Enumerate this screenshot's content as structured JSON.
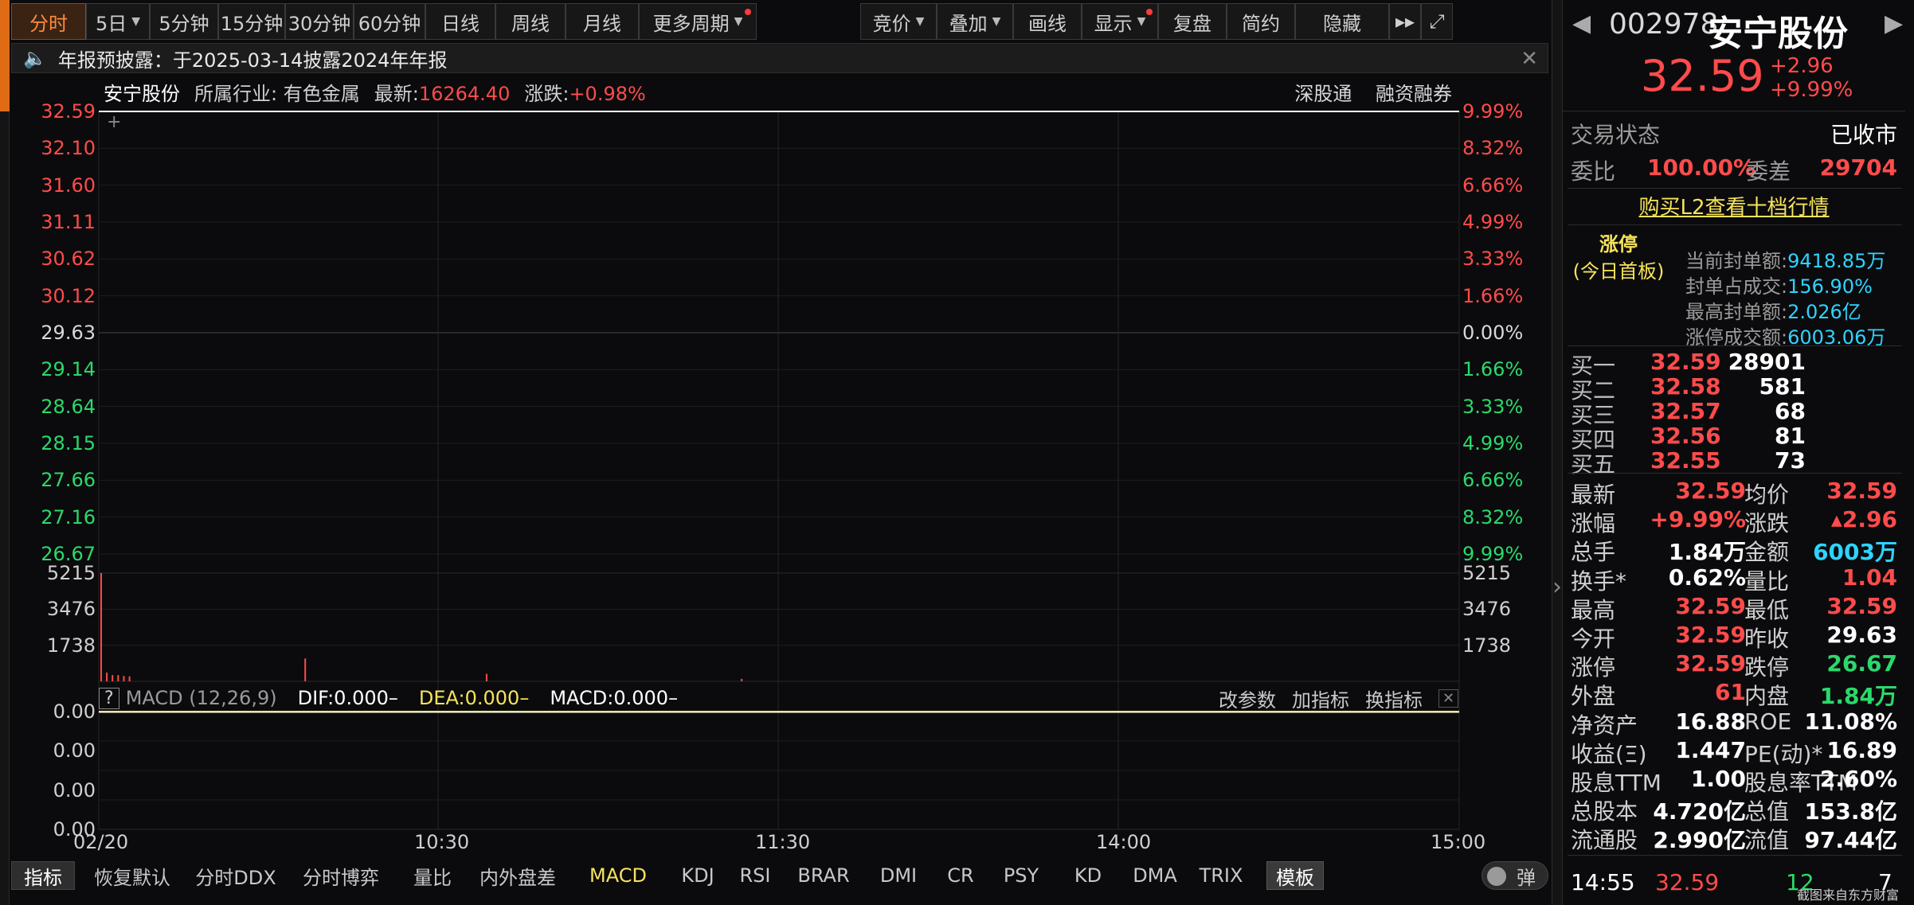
{
  "toolbar": {
    "items": [
      {
        "label": "分时",
        "active": true
      },
      {
        "label": "5日",
        "dropdown": true
      },
      {
        "label": "5分钟"
      },
      {
        "label": "15分钟"
      },
      {
        "label": "30分钟"
      },
      {
        "label": "60分钟"
      },
      {
        "label": "日线"
      },
      {
        "label": "周线"
      },
      {
        "label": "月线"
      },
      {
        "label": "更多周期",
        "dropdown": true,
        "dot": true
      },
      {
        "label": "竞价",
        "dropdown": true
      },
      {
        "label": "叠加",
        "dropdown": true
      },
      {
        "label": "画线"
      },
      {
        "label": "显示",
        "dropdown": true,
        "dot": true
      },
      {
        "label": "复盘"
      },
      {
        "label": "简约"
      },
      {
        "label": "隐藏"
      }
    ]
  },
  "announcement": {
    "text": "年报预披露：于2025-03-14披露2024年年报"
  },
  "info": {
    "stock": "安宁股份",
    "industry_label": "所属行业:",
    "industry": "有色金属",
    "latest_label": "最新:",
    "latest": "16264.40",
    "change_label": "涨跌:",
    "change": "+0.98%",
    "link1": "深股通",
    "link2": "融资融券"
  },
  "price_axis": {
    "left": [
      "32.59",
      "32.10",
      "31.60",
      "31.11",
      "30.62",
      "30.12",
      "29.63",
      "29.14",
      "28.64",
      "28.15",
      "27.66",
      "27.16",
      "26.67"
    ],
    "right": [
      "9.99%",
      "8.32%",
      "6.66%",
      "4.99%",
      "3.33%",
      "1.66%",
      "0.00%",
      "1.66%",
      "3.33%",
      "4.99%",
      "6.66%",
      "8.32%",
      "9.99%"
    ]
  },
  "volume_axis": [
    "5215",
    "3476",
    "1738"
  ],
  "macd_axis": [
    "0.00",
    "0.00",
    "0.00",
    "0.00"
  ],
  "time_axis": [
    "02/20",
    "10:30",
    "11:30",
    "14:00",
    "15:00"
  ],
  "chart_data": {
    "type": "line",
    "title": "",
    "price_line": {
      "x": [
        "09:30",
        "15:00"
      ],
      "y": [
        32.59,
        32.59
      ]
    },
    "prev_close": 29.63,
    "ylim": [
      26.67,
      32.59
    ],
    "volume": {
      "x": [
        "09:30",
        "09:31",
        "09:32",
        "09:33",
        "09:34",
        "09:35",
        "10:06",
        "10:38",
        "11:23"
      ],
      "y": [
        5215,
        420,
        300,
        300,
        260,
        240,
        1100,
        360,
        120
      ]
    },
    "volume_ylim": [
      0,
      5215
    ],
    "macd": {
      "DIF": 0.0,
      "DEA": 0.0,
      "MACD": 0.0
    }
  },
  "macd_bar": {
    "help": "?",
    "name": "MACD (12,26,9)",
    "dif": "DIF:0.000–",
    "dea": "DEA:0.000–",
    "macd": "MACD:0.000–",
    "actions": [
      "改参数",
      "加指标",
      "换指标"
    ]
  },
  "bottom_bar": {
    "items": [
      "指标",
      "恢复默认",
      "分时DDX",
      "分时博弈",
      "量比",
      "内外盘差",
      "MACD",
      "KDJ",
      "RSI",
      "BRAR",
      "DMI",
      "CR",
      "PSY",
      "KD",
      "DMA",
      "TRIX"
    ],
    "template": "模板",
    "toggle": "弹"
  },
  "quote": {
    "code": "002978",
    "name": "安宁股份",
    "price": "32.59",
    "change": "+2.96",
    "change_pct": "+9.99%",
    "status_label": "交易状态",
    "status": "已收市",
    "ratio_label": "委比",
    "ratio": "100.00%",
    "diff_label": "委差",
    "diff": "29704",
    "l2_link": "购买L2查看十档行情",
    "limit_title": "涨停",
    "limit_sub": "(今日首板)",
    "limit_rows": [
      {
        "k": "当前封单额:",
        "v": "9418.85万"
      },
      {
        "k": "封单占成交:",
        "v": "156.90%"
      },
      {
        "k": "最高封单额:",
        "v": "2.026亿"
      },
      {
        "k": "涨停成交额:",
        "v": "6003.06万"
      }
    ],
    "orderbook": [
      {
        "k": "买一",
        "p": "32.59",
        "q": "28901"
      },
      {
        "k": "买二",
        "p": "32.58",
        "q": "581"
      },
      {
        "k": "买三",
        "p": "32.57",
        "q": "68"
      },
      {
        "k": "买四",
        "p": "32.56",
        "q": "81"
      },
      {
        "k": "买五",
        "p": "32.55",
        "q": "73"
      }
    ],
    "stats": [
      {
        "k": "最新",
        "v": "32.59",
        "c": "red",
        "k2": "均价",
        "v2": "32.59",
        "c2": "red"
      },
      {
        "k": "涨幅",
        "v": "+9.99%",
        "c": "red",
        "k2": "涨跌",
        "v2": "▴2.96",
        "c2": "red"
      },
      {
        "k": "总手",
        "v": "1.84万",
        "c": "wht",
        "k2": "金额",
        "v2": "6003万",
        "c2": "cyan"
      },
      {
        "k": "换手*",
        "v": "0.62%",
        "c": "wht",
        "k2": "量比",
        "v2": "1.04",
        "c2": "red"
      },
      {
        "k": "最高",
        "v": "32.59",
        "c": "red",
        "k2": "最低",
        "v2": "32.59",
        "c2": "red"
      },
      {
        "k": "今开",
        "v": "32.59",
        "c": "red",
        "k2": "昨收",
        "v2": "29.63",
        "c2": "wht"
      },
      {
        "k": "涨停",
        "v": "32.59",
        "c": "red",
        "k2": "跌停",
        "v2": "26.67",
        "c2": "grn"
      },
      {
        "k": "外盘",
        "v": "61",
        "c": "red",
        "k2": "内盘",
        "v2": "1.84万",
        "c2": "grn"
      },
      {
        "k": "净资产",
        "v": "16.88",
        "c": "wht",
        "k2": "ROE",
        "v2": "11.08%",
        "c2": "wht"
      },
      {
        "k": "收益(Ξ)",
        "v": "1.447",
        "c": "wht",
        "k2": "PE(动)*",
        "v2": "16.89",
        "c2": "wht"
      },
      {
        "k": "股息TTM",
        "v": "1.00",
        "c": "wht",
        "k2": "股息率TTM",
        "v2": "2.60%",
        "c2": "wht"
      },
      {
        "k": "总股本",
        "v": "4.720亿",
        "c": "wht",
        "k2": "总值",
        "v2": "153.8亿",
        "c2": "wht"
      },
      {
        "k": "流通股",
        "v": "2.990亿",
        "c": "wht",
        "k2": "流值",
        "v2": "97.44亿",
        "c2": "wht"
      }
    ],
    "tick": {
      "time": "14:55",
      "price": "32.59",
      "vol": "12",
      "n": "7"
    }
  },
  "watermark": "截图来自东方财富",
  "colors": {
    "up": "#ff4b4b",
    "down": "#2bd96b",
    "accent": "#ff8a3d",
    "macd_line": "#f6e35a"
  }
}
